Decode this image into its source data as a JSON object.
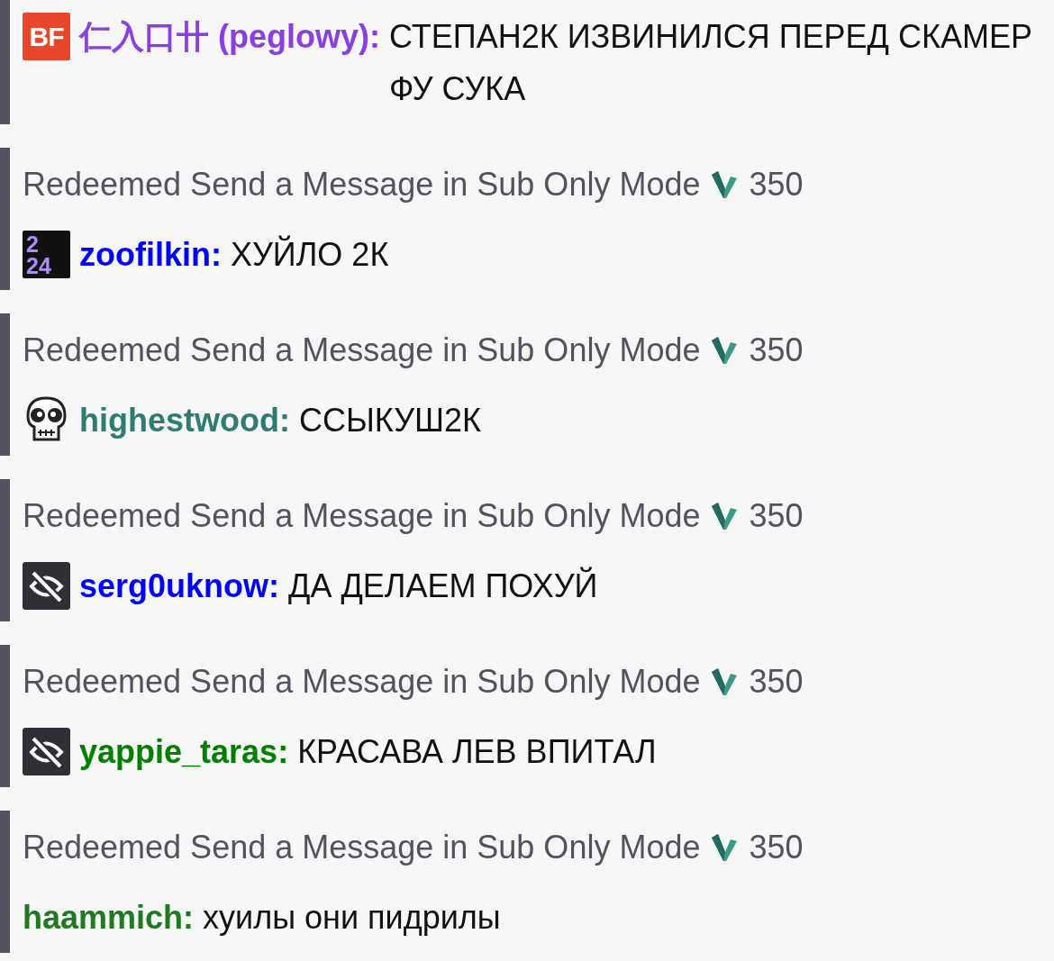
{
  "messages": [
    {
      "badge": {
        "kind": "bf",
        "text": "BF"
      },
      "user": "仁入口卄 (peglowy):",
      "color": "#8a3fe0",
      "text": "СТЕПАН2К ИЗВИНИЛСЯ ПЕРЕД СКАМЕР ФУ СУКА"
    },
    {
      "redeemed": {
        "label": "Redeemed Send a Message in Sub Only Mode",
        "cost": "350"
      },
      "badge": {
        "kind": "year",
        "lines": [
          "2",
          "24"
        ]
      },
      "user": "zoofilkin:",
      "color": "#0000ff",
      "text": "ХУЙЛО 2К"
    },
    {
      "redeemed": {
        "label": "Redeemed Send a Message in Sub Only Mode",
        "cost": "350"
      },
      "badge": {
        "kind": "skull"
      },
      "user": "highestwood:",
      "color": "#2e7d70",
      "text": "ССЫКУШ2К"
    },
    {
      "redeemed": {
        "label": "Redeemed Send a Message in Sub Only Mode",
        "cost": "350"
      },
      "badge": {
        "kind": "hidden"
      },
      "user": "serg0uknow:",
      "color": "#0000ff",
      "text": "ДА ДЕЛАЕМ ПОХУЙ"
    },
    {
      "redeemed": {
        "label": "Redeemed Send a Message in Sub Only Mode",
        "cost": "350"
      },
      "badge": {
        "kind": "hidden"
      },
      "user": "yappie_taras:",
      "color": "#008000",
      "text": "КРАСАВА ЛЕВ ВПИТАЛ"
    },
    {
      "redeemed": {
        "label": "Redeemed Send a Message in Sub Only Mode",
        "cost": "350"
      },
      "user": "haammich:",
      "color": "#1f7a1f",
      "text": "хуилы они пидрилы"
    }
  ]
}
